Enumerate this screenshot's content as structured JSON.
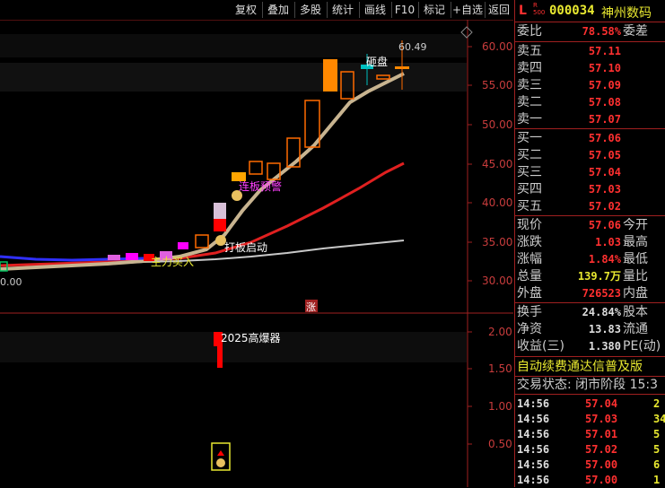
{
  "toolbar": {
    "buttons": [
      "复权",
      "叠加",
      "多股",
      "统计",
      "画线",
      "F10",
      "标记",
      "+自选",
      "返回"
    ]
  },
  "price_axis": [
    "60.00",
    "55.00",
    "50.00",
    "45.00",
    "40.00",
    "35.00",
    "30.00"
  ],
  "indicator_axis": [
    "2.00",
    "1.50",
    "1.00",
    "0.50"
  ],
  "chart_labels": {
    "high_price": "60.49",
    "low_price_fragment": "0.00",
    "smash": "砸盘",
    "limit_up_forecast": "连板预警",
    "board_start": "打板启动",
    "main_buy": "主力买入",
    "rise_marker": "涨",
    "burst_label": "2025高爆器"
  },
  "stock": {
    "badge_top": "L",
    "badge_sub": "R\n500",
    "code": "000034",
    "name": "神州数码"
  },
  "order_book": {
    "webi_label": "委比",
    "webi_value": "78.58%",
    "webi_diff_label": "委差",
    "asks": [
      {
        "label": "卖五",
        "price": "57.11"
      },
      {
        "label": "卖四",
        "price": "57.10"
      },
      {
        "label": "卖三",
        "price": "57.09"
      },
      {
        "label": "卖二",
        "price": "57.08"
      },
      {
        "label": "卖一",
        "price": "57.07"
      }
    ],
    "bids": [
      {
        "label": "买一",
        "price": "57.06"
      },
      {
        "label": "买二",
        "price": "57.05"
      },
      {
        "label": "买三",
        "price": "57.04"
      },
      {
        "label": "买四",
        "price": "57.03"
      },
      {
        "label": "买五",
        "price": "57.02"
      }
    ]
  },
  "quote": [
    {
      "label": "现价",
      "value": "57.06",
      "label2": "今开",
      "color": "#ff3030"
    },
    {
      "label": "涨跌",
      "value": "1.03",
      "label2": "最高",
      "color": "#ff3030"
    },
    {
      "label": "涨幅",
      "value": "1.84%",
      "label2": "最低",
      "color": "#ff3030"
    },
    {
      "label": "总量",
      "value": "139.7万",
      "label2": "量比",
      "color": "#e8e830"
    },
    {
      "label": "外盘",
      "value": "726523",
      "label2": "内盘",
      "color": "#ff3030"
    }
  ],
  "stats": [
    {
      "label": "换手",
      "value": "24.84%",
      "label2": "股本"
    },
    {
      "label": "净资",
      "value": "13.83",
      "label2": "流通"
    },
    {
      "label": "收益(三)",
      "value": "1.380",
      "label2": "PE(动)"
    }
  ],
  "notice": "自动续费通达信普及版",
  "status": "交易状态: 闭市阶段 15:3",
  "ticks": [
    {
      "time": "14:56",
      "price": "57.04",
      "vol": "2"
    },
    {
      "time": "14:56",
      "price": "57.03",
      "vol": "34"
    },
    {
      "time": "14:56",
      "price": "57.01",
      "vol": "5"
    },
    {
      "time": "14:56",
      "price": "57.02",
      "vol": "5"
    },
    {
      "time": "14:56",
      "price": "57.00",
      "vol": "6"
    },
    {
      "time": "14:56",
      "price": "57.00",
      "vol": "1"
    }
  ],
  "colors": {
    "up": "#ff3030",
    "down": "#00c0c0",
    "ma_slow": "#c8c8c8",
    "ma_mid": "#e02020",
    "ma_fast": "#c8b490",
    "highlight": "#e8e830"
  }
}
